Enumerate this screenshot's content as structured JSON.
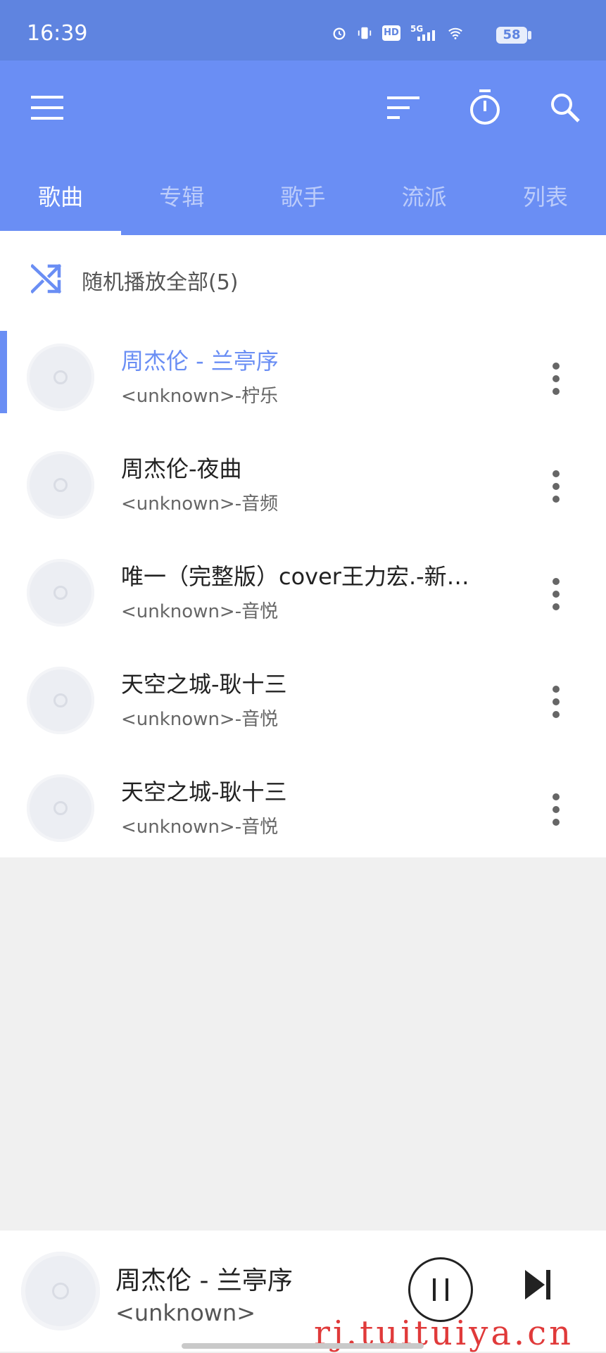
{
  "status": {
    "time": "16:39",
    "battery": "58",
    "network_label": "5G",
    "hd_label": "HD"
  },
  "app_bar": {
    "tabs": [
      {
        "label": "歌曲",
        "active": true
      },
      {
        "label": "专辑",
        "active": false
      },
      {
        "label": "歌手",
        "active": false
      },
      {
        "label": "流派",
        "active": false
      },
      {
        "label": "列表",
        "active": false
      }
    ],
    "icons": [
      "menu-icon",
      "sort-icon",
      "timer-icon",
      "search-icon"
    ]
  },
  "shuffle": {
    "label": "随机播放全部(5)",
    "icon": "shuffle-icon"
  },
  "songs": [
    {
      "title": "周杰伦 - 兰亭序",
      "subtitle": "<unknown>-柠乐",
      "active": true
    },
    {
      "title": "周杰伦-夜曲",
      "subtitle": "<unknown>-音频",
      "active": false
    },
    {
      "title": "唯一（完整版）cover王力宏.-新…",
      "subtitle": "<unknown>-音悦",
      "active": false
    },
    {
      "title": "天空之城-耿十三",
      "subtitle": "<unknown>-音悦",
      "active": false
    },
    {
      "title": "天空之城-耿十三",
      "subtitle": "<unknown>-音悦",
      "active": false
    }
  ],
  "player": {
    "title": "周杰伦 - 兰亭序",
    "subtitle": "<unknown>",
    "state": "playing"
  },
  "watermark": "rj.tuituiya.cn",
  "colors": {
    "status_bar": "#5f84e0",
    "app_bar": "#6a8ef4",
    "accent": "#6a8ef4",
    "list_bg": "#ffffff",
    "empty_bg": "#f0f0f0",
    "watermark": "#e03a3a"
  }
}
